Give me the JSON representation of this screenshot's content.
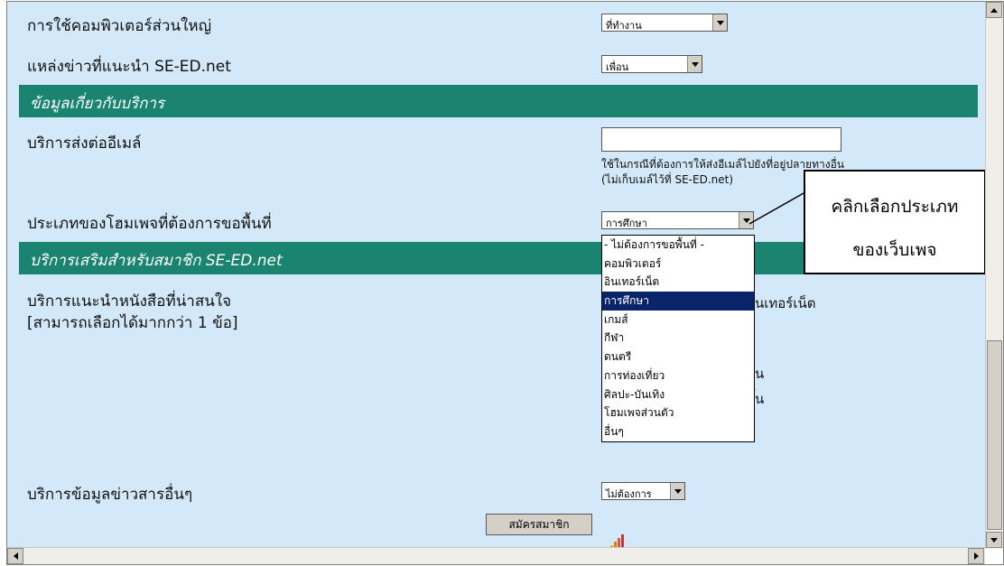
{
  "form": {
    "computer_use_label": "การใช้คอมพิวเตอร์ส่วนใหญ่",
    "computer_use_value": "ที่ทำงาน",
    "news_source_label": "แหล่งข่าวที่แนะนำ SE-ED.net",
    "news_source_value": "เพื่อน",
    "section_services": "ข้อมูลเกี่ยวกับบริการ",
    "forward_email_label": "บริการส่งต่ออีเมล์",
    "forward_email_hint_1": "ใช้ในกรณีที่ต้องการให้ส่งอีเมล์ไปยังที่อยู่ปลายทางอื่น",
    "forward_email_hint_2": "(ไม่เก็บเมล์ไว้ที่ SE-ED.net)",
    "homepage_type_label": "ประเภทของโฮมเพจที่ต้องการขอพื้นที่",
    "homepage_type_value": "การศึกษา",
    "section_member_services": "บริการเสริมสำหรับสมาชิก SE-ED.net",
    "book_recommend_label": "บริการแนะนำหนังสือที่น่าสนใจ",
    "book_recommend_note": "[สามารถเลือกได้มากกว่า 1 ข้อ]",
    "book_option_partial_1": "ินเทอร์เน็ต",
    "book_option_partial_2": "น",
    "book_option_partial_3": "ั้น",
    "other_news_label": "บริการข้อมูลข่าวสารอื่นๆ",
    "other_news_value": "ไม่ต้องการ",
    "submit_label": "สมัครสมาชิก"
  },
  "dropdown": {
    "options": [
      "- ไม่ต้องการขอพื้นที่ -",
      "คอมพิวเตอร์",
      "อินเทอร์เน็ต",
      "การศึกษา",
      "เกมส์",
      "กีฬา",
      "ดนตรี",
      "การท่องเที่ยว",
      "ศิลปะ-บันเทิง",
      "โฮมเพจส่วนตัว",
      "อื่นๆ"
    ],
    "selected_index": 3
  },
  "callout": {
    "line1": "คลิกเลือกประเภท",
    "line2": "ของเว็บเพจ"
  },
  "colors": {
    "background": "#d3e8f8",
    "section_bar": "#1a8470",
    "selection": "#0a246a"
  }
}
